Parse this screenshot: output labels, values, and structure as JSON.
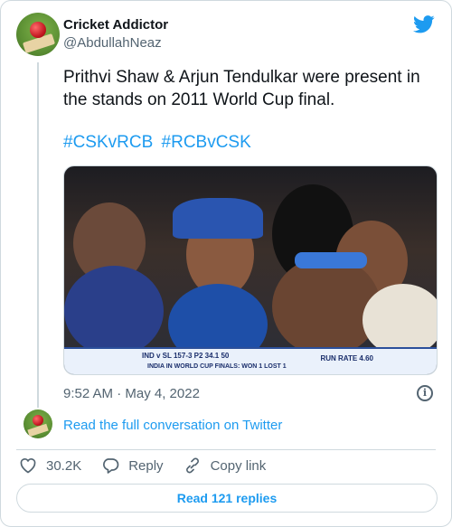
{
  "author": {
    "name": "Cricket Addictor",
    "handle": "@AbdullahNeaz"
  },
  "tweet": {
    "text": "Prithvi Shaw & Arjun Tendulkar were present in the stands on 2011 World Cup final.",
    "hashtags": [
      "#CSKvRCB",
      "#RCBvCSK"
    ],
    "timestamp": "9:52 AM · May 4, 2022"
  },
  "media": {
    "score_line": "IND v SL   157-3  P2  34.1  50",
    "sub_line": "INDIA IN WORLD CUP FINALS: WON 1   LOST 1",
    "run_rate": "RUN RATE  4.60"
  },
  "conversation_link": "Read the full conversation on Twitter",
  "actions": {
    "likes": "30.2K",
    "reply_label": "Reply",
    "copy_label": "Copy link"
  },
  "read_replies": "Read 121 replies",
  "colors": {
    "accent": "#1d9bf0",
    "muted": "#536471",
    "like": "#f91880"
  },
  "icons": [
    "twitter-bird-icon",
    "info-icon",
    "heart-icon",
    "reply-icon",
    "link-icon"
  ]
}
